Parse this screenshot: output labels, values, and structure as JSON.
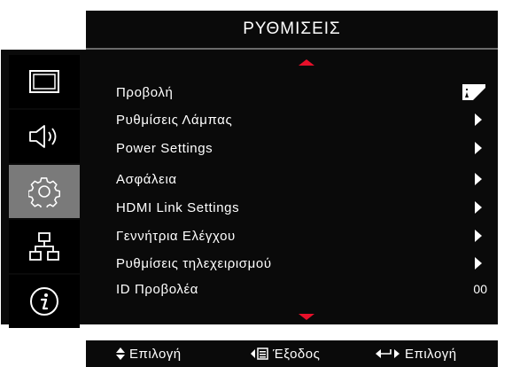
{
  "header": {
    "title": "ΡΥΘΜΙΣΕΙΣ"
  },
  "tabs": [
    {
      "icon": "picture-icon",
      "active": false
    },
    {
      "icon": "speaker-icon",
      "active": false
    },
    {
      "icon": "settings-gear-icon",
      "active": true
    },
    {
      "icon": "network-icon",
      "active": false
    },
    {
      "icon": "info-icon",
      "active": false
    }
  ],
  "menu": {
    "items": [
      {
        "label": "Προβολή",
        "control": "projection-mode-icon"
      },
      {
        "label": "Ρυθμίσεις Λάμπας",
        "control": "submenu-arrow"
      },
      {
        "label": "Power Settings",
        "control": "submenu-arrow"
      },
      {
        "label": "Ασφάλεια",
        "control": "submenu-arrow"
      },
      {
        "label": "HDMI Link Settings",
        "control": "submenu-arrow"
      },
      {
        "label": "Γεννήτρια Ελέγχου",
        "control": "submenu-arrow"
      },
      {
        "label": "Ρυθμίσεις τηλεχειρισμού",
        "control": "submenu-arrow"
      },
      {
        "label": "ID Προβολέα",
        "value": "00"
      }
    ],
    "scroll_color": "#e8102a"
  },
  "footer": {
    "select_hint": "Επιλογή",
    "exit_hint": "Έξοδος",
    "enter_hint": "Επιλογή"
  }
}
